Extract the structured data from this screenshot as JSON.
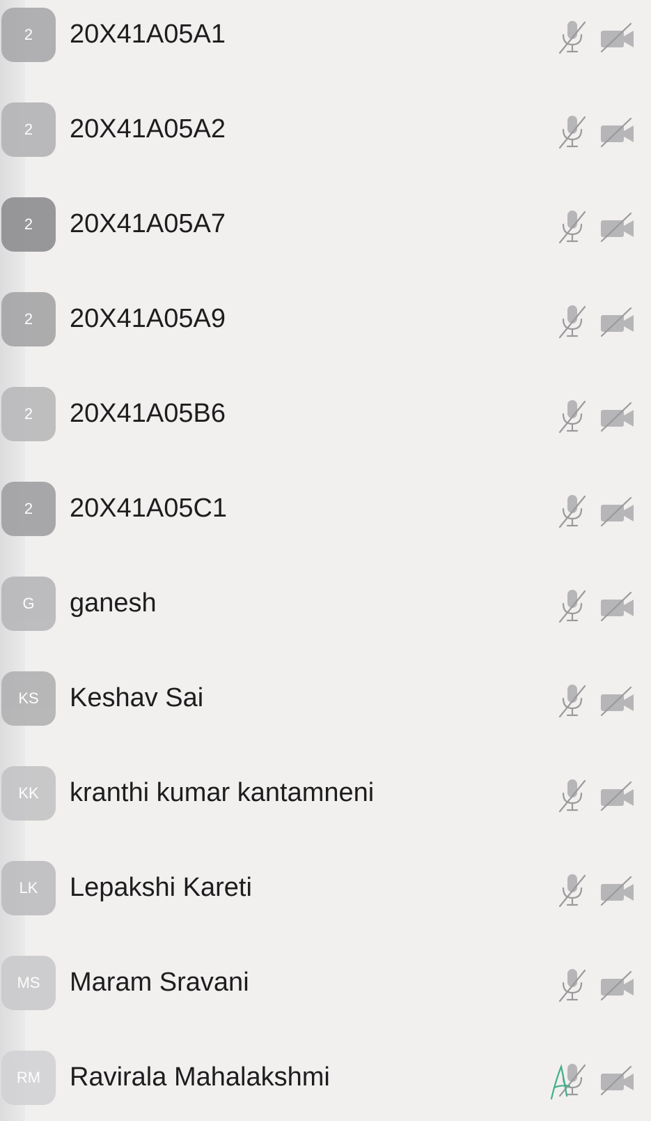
{
  "participants": [
    {
      "initials": "2",
      "name": "20X41A05A1",
      "avatar_color": "#a9a9ab"
    },
    {
      "initials": "2",
      "name": "20X41A05A2",
      "avatar_color": "#b4b4b6"
    },
    {
      "initials": "2",
      "name": "20X41A05A7",
      "avatar_color": "#8e8e90"
    },
    {
      "initials": "2",
      "name": "20X41A05A9",
      "avatar_color": "#a5a5a7"
    },
    {
      "initials": "2",
      "name": "20X41A05B6",
      "avatar_color": "#b9b9bb"
    },
    {
      "initials": "2",
      "name": "20X41A05C1",
      "avatar_color": "#a0a0a2"
    },
    {
      "initials": "G",
      "name": "ganesh",
      "avatar_color": "#b7b7b9"
    },
    {
      "initials": "KS",
      "name": "Keshav Sai",
      "avatar_color": "#b1b1b3"
    },
    {
      "initials": "KK",
      "name": "kranthi kumar kantamneni",
      "avatar_color": "#c4c4c6"
    },
    {
      "initials": "LK",
      "name": "Lepakshi Kareti",
      "avatar_color": "#bdbdbf"
    },
    {
      "initials": "MS",
      "name": "Maram Sravani",
      "avatar_color": "#cacacc"
    },
    {
      "initials": "RM",
      "name": "Ravirala Mahalakshmi",
      "avatar_color": "#d2d2d4"
    }
  ],
  "icons": {
    "mic": "mic-muted-icon",
    "camera": "video-off-icon"
  },
  "colors": {
    "icon": "#9a9a9c",
    "text": "#1d1d1f",
    "background": "#f1f0ee",
    "annotation": "#3fae8a"
  }
}
